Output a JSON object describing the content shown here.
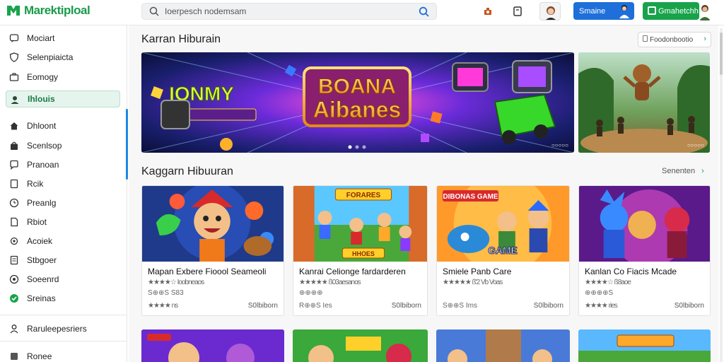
{
  "app": {
    "logo_text": "Marektiploal"
  },
  "search": {
    "value": "Ioerpesch nodemsam"
  },
  "header": {
    "primary_button": "Smaine",
    "green_button": "Gmahetchh"
  },
  "sidebar": {
    "items": [
      {
        "label": "Mociart",
        "icon": "chat-icon"
      },
      {
        "label": "Selenpiaicta",
        "icon": "shield-icon"
      },
      {
        "label": "Eomogy",
        "icon": "briefcase-icon"
      },
      {
        "label": "Ihlouis",
        "icon": "person-icon",
        "active": true
      },
      {
        "label": "Dhloont",
        "icon": "home-icon"
      },
      {
        "label": "Scenlsop",
        "icon": "bag-icon"
      },
      {
        "label": "Pranoan",
        "icon": "speech-icon"
      },
      {
        "label": "Rcik",
        "icon": "document-icon"
      },
      {
        "label": "Preanlg",
        "icon": "clock-icon"
      },
      {
        "label": "Rbiot",
        "icon": "file-icon"
      },
      {
        "label": "Acoiek",
        "icon": "gear-icon"
      },
      {
        "label": "Stbgoer",
        "icon": "doc-lines-icon"
      },
      {
        "label": "Soeenrd",
        "icon": "circle-icon"
      },
      {
        "label": "Sreinas",
        "icon": "green-check-icon"
      }
    ],
    "footer_items": [
      {
        "label": "Raruleepesriers",
        "icon": "user-icon"
      },
      {
        "label": "Ronee",
        "icon": "square-icon"
      }
    ]
  },
  "main": {
    "section1_title": "Karran Hiburain",
    "section1_link": "Foodonbootio",
    "banner_main_label": "○○○○○",
    "banner_main_text": "BOANA Aibanes",
    "banner_main_left_text": "IONMY",
    "banner_side_label": "○○○○○",
    "section2_title": "Kaggarn Hibuuran",
    "section2_link": "Senenten",
    "cards": [
      {
        "title": "Mapan Exbere Fioool Seameoli",
        "meta": "★★★★☆ Ioobneaos",
        "meta2": "S⊕⊕S S83",
        "bottom_left": "★★★★ ns",
        "bottom_right": "S0lbiborn"
      },
      {
        "title": "Kanrai Celionge fardarderen",
        "meta": "★★★★★ ß03aesanos",
        "meta2": "⊕⊕⊕⊕",
        "bottom_left": "R⊕⊕S Ies",
        "bottom_right": "S0lbiborn"
      },
      {
        "title": "Smiele Panb Care",
        "meta": "★★★★★ ß'2 Vb Voas",
        "meta2": "",
        "bottom_left": "S⊕⊕S Ims",
        "bottom_right": "S0lbiborn"
      },
      {
        "title": "Kanlan Co Fiacis Mcade",
        "meta": "★★★★☆ ß8aoe",
        "meta2": "⊕⊕⊕⊕S",
        "bottom_left": "★★★★ ries",
        "bottom_right": "S0lbiborn"
      }
    ],
    "card_thumb_texts": [
      "",
      "FORARES",
      "DIBONAS GAME",
      ""
    ],
    "card_thumb_bottom_texts": [
      "",
      "HHOES",
      "GAME",
      ""
    ]
  },
  "colors": {
    "brand_green": "#18a34a",
    "primary_blue": "#1e6fd9",
    "active_bg": "#e6f4ee"
  }
}
